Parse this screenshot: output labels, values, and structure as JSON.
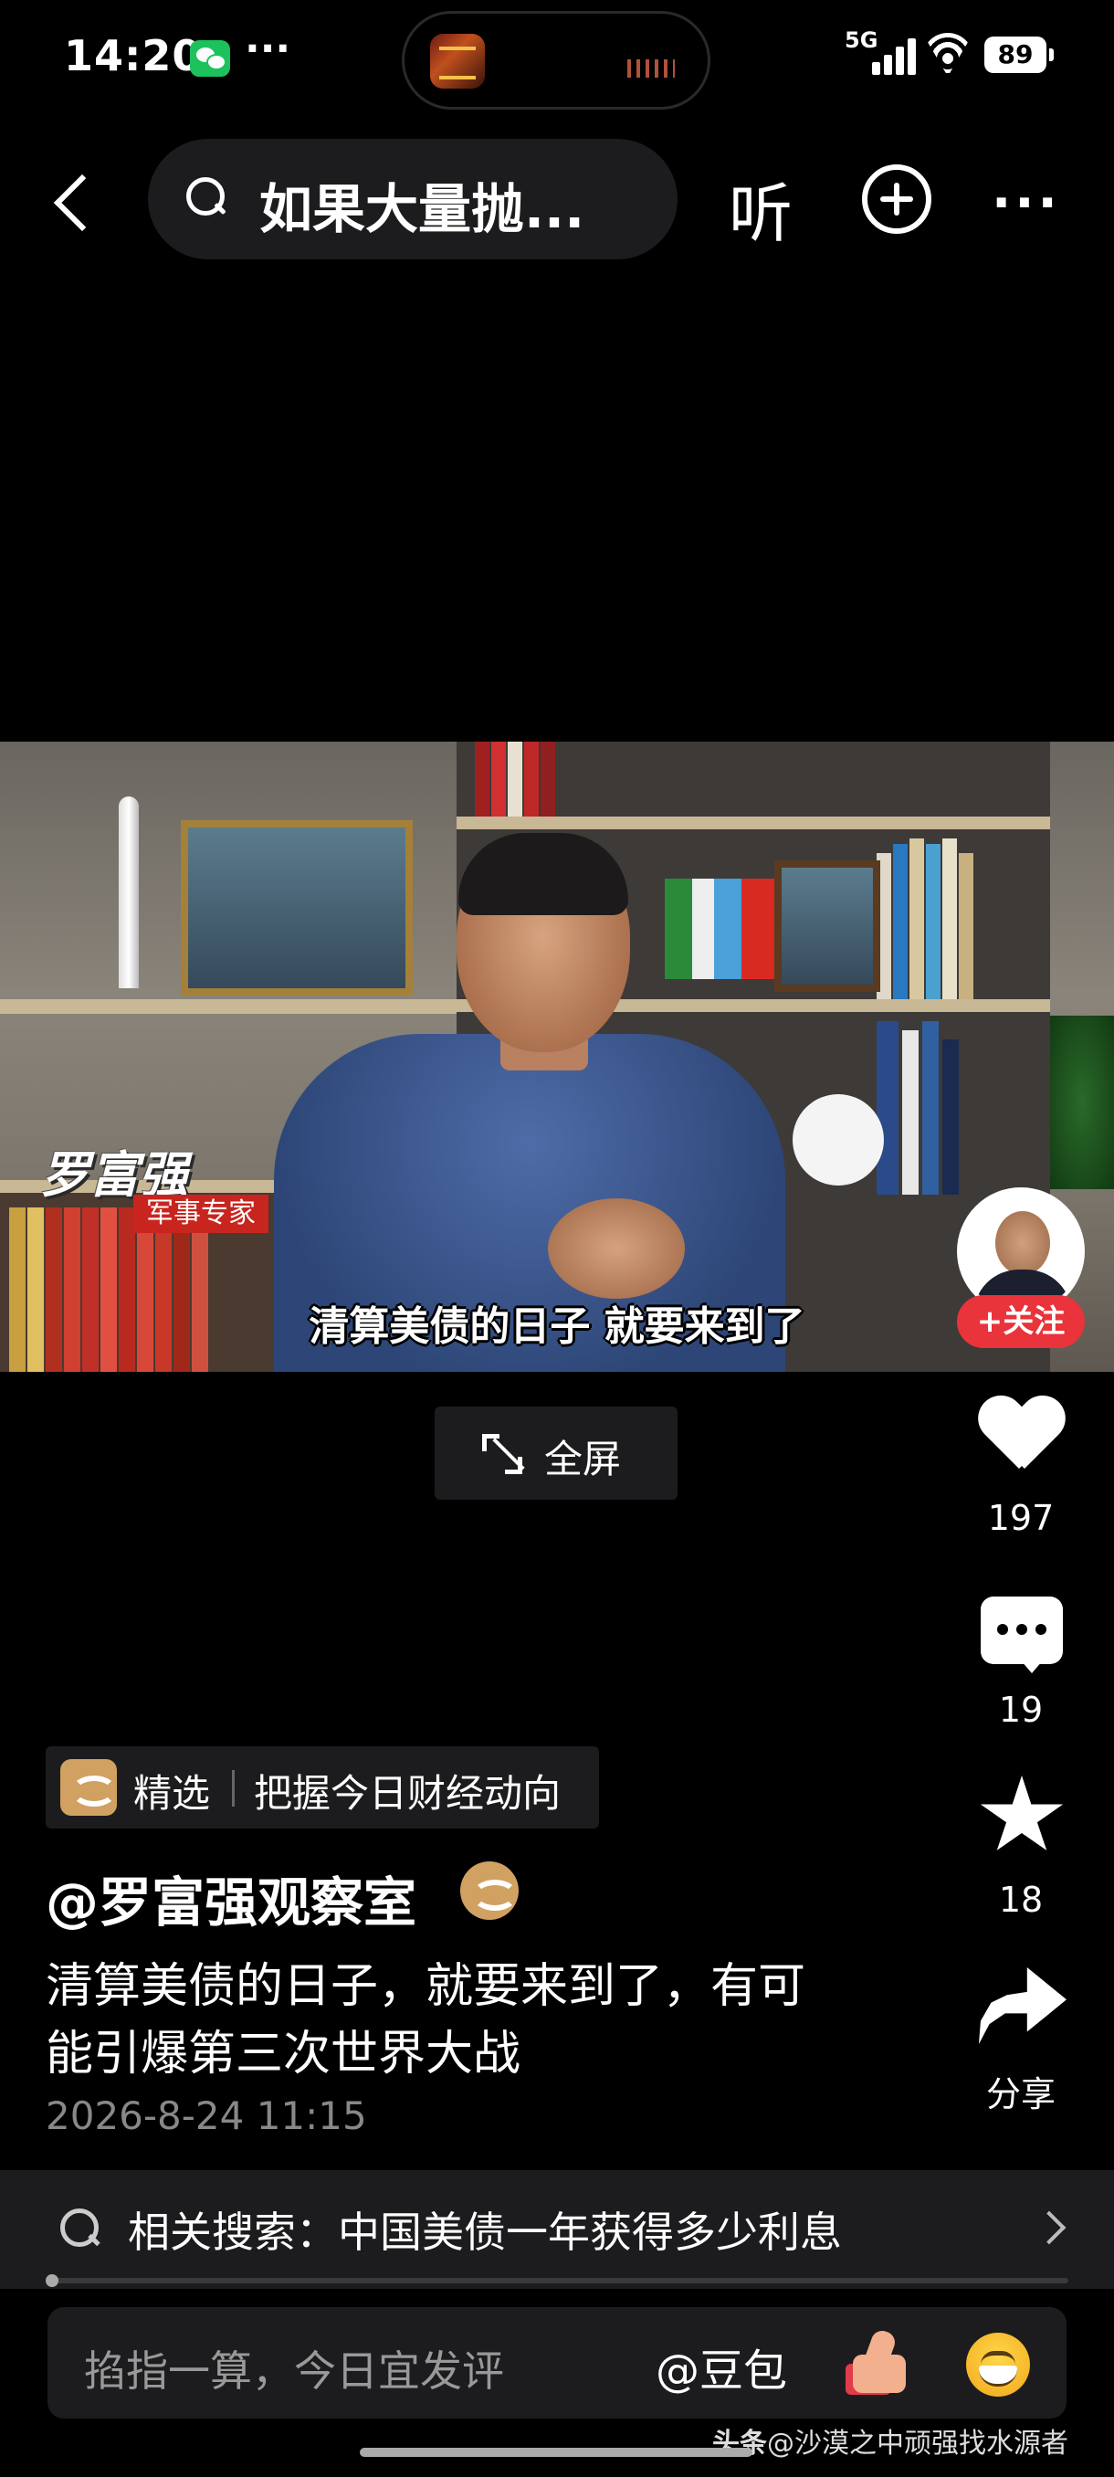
{
  "status_bar": {
    "time": "14:20",
    "dots": "···",
    "network": "5G",
    "battery": "89"
  },
  "top_bar": {
    "search_query": "如果大量抛...",
    "listen_label": "听",
    "more_label": "···"
  },
  "video": {
    "speaker_name": "罗富强",
    "speaker_role": "军事专家",
    "subtitle": "清算美债的日子 就要来到了",
    "follow_label": "+关注",
    "fullscreen_label": "全屏"
  },
  "actions": {
    "likes": "197",
    "comments": "19",
    "favorites": "18",
    "share_label": "分享"
  },
  "post": {
    "badge_label": "精选",
    "badge_text": "把握今日财经动向",
    "author": "@罗富强观察室",
    "description_lines": [
      "清算美债的日子，就要来到了，有可",
      "能引爆第三次世界大战"
    ],
    "timestamp": "2026-8-24 11:15"
  },
  "related_search": {
    "text": "相关搜索：中国美债一年获得多少利息"
  },
  "comment_bar": {
    "placeholder": "掐指一算，今日宜发评",
    "mention_label": "@豆包"
  },
  "watermark": {
    "source": "头条",
    "handle": "@沙漠之中顽强找水源者"
  },
  "colors": {
    "background": "#000000",
    "panel": "#1c1c1e",
    "follow_red": "#e8343a",
    "verified_gold": "#d1a161"
  }
}
